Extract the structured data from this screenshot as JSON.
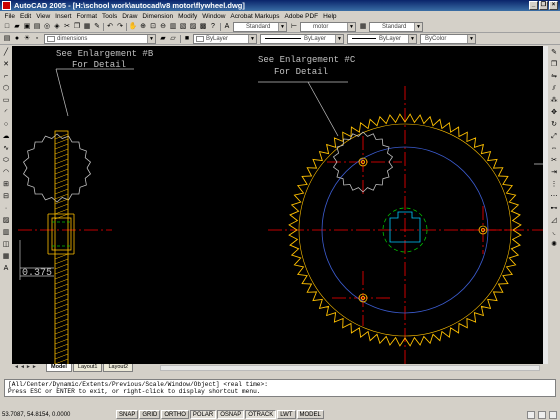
{
  "window": {
    "app_title": "AutoCAD 2005 - [H:\\school work\\autocad\\v8 motor\\flywheel.dwg]",
    "controls": [
      "_",
      "❐",
      "×"
    ]
  },
  "menu": [
    "File",
    "Edit",
    "View",
    "Insert",
    "Format",
    "Tools",
    "Draw",
    "Dimension",
    "Modify",
    "Window",
    "Acrobat Markups",
    "Adobe PDF",
    "Help"
  ],
  "toolbars": {
    "text_style": "Standard",
    "dim_style": "motor",
    "table_style": "Standard",
    "layer": "dimensions",
    "color": "ByLayer",
    "linetype": "ByLayer",
    "lineweight": "ByLayer",
    "plot_style": "ByColor"
  },
  "drawing": {
    "note_b_line1": "See Enlargement #B",
    "note_b_line2": "For Detail",
    "note_c_line1": "See Enlargement #C",
    "note_c_line2": "For Detail",
    "dim_value": "0.375"
  },
  "tabs": {
    "model": "Model",
    "layout1": "Layout1",
    "layout2": "Layout2",
    "nav": "◄◄►►"
  },
  "command": {
    "line1": "[All/Center/Dynamic/Extents/Previous/Scale/Window/Object] <real time>:",
    "line2": "Press ESC or ENTER to exit, or right-click to display shortcut menu."
  },
  "status": {
    "coords": "53.7087, 54.8154, 0.0000",
    "buttons": [
      "SNAP",
      "GRID",
      "ORTHO",
      "POLAR",
      "OSNAP",
      "OTRACK",
      "LWT",
      "MODEL"
    ]
  },
  "colors": {
    "canvas_bg": "#000000",
    "centerline": "#ff0000",
    "gear": "#ffc000",
    "circle_blue": "#3c5cd0",
    "hidden_green": "#00c000",
    "annotation": "#c0c0c0",
    "hub": "#00c8ff"
  }
}
